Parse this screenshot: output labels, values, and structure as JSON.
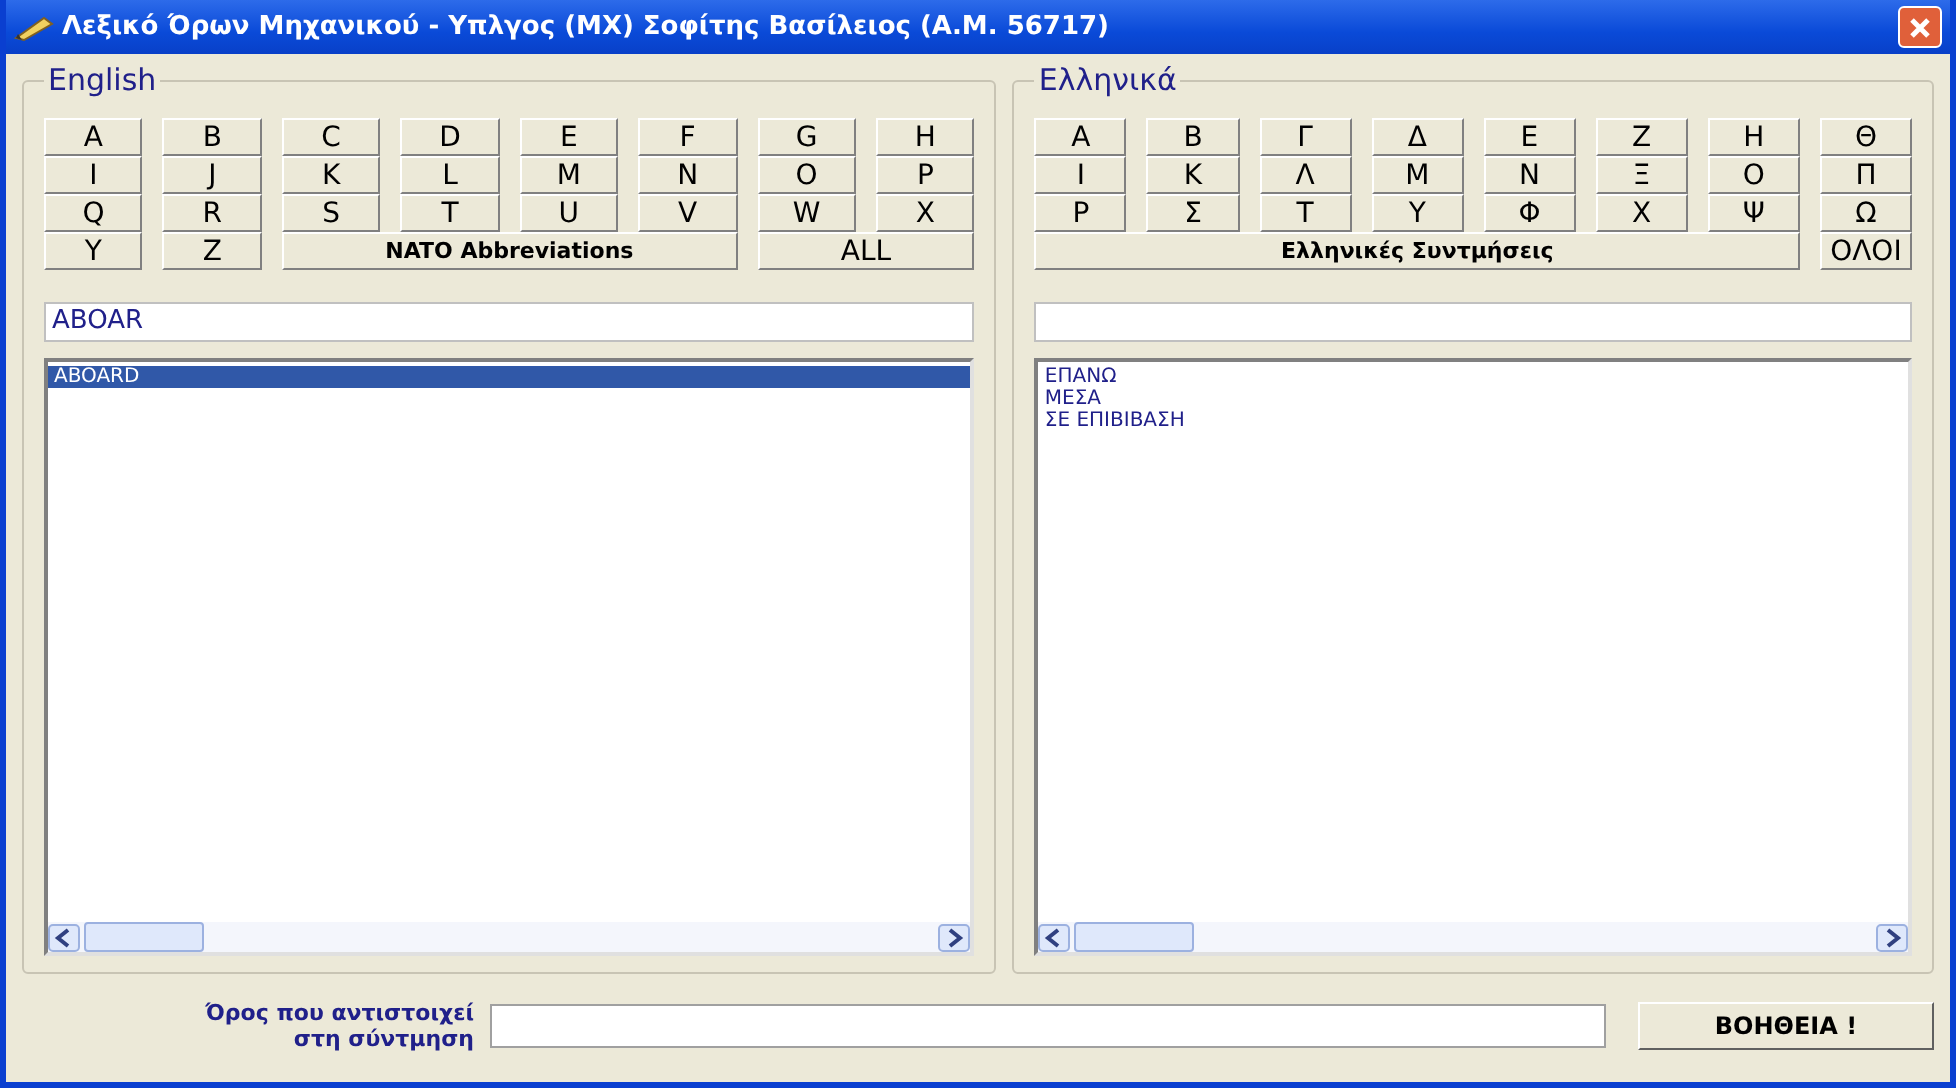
{
  "window": {
    "title": "Λεξικό Όρων Μηχανικού - Υπλγος (ΜΧ) Σοφίτης Βασίλειος (Α.Μ. 56717)"
  },
  "panels": [
    {
      "title": "English",
      "keys": [
        {
          "label": "A",
          "kind": "letter"
        },
        {
          "label": "B",
          "kind": "letter"
        },
        {
          "label": "C",
          "kind": "letter"
        },
        {
          "label": "D",
          "kind": "letter"
        },
        {
          "label": "E",
          "kind": "letter"
        },
        {
          "label": "F",
          "kind": "letter"
        },
        {
          "label": "G",
          "kind": "letter"
        },
        {
          "label": "H",
          "kind": "letter"
        },
        {
          "label": "I",
          "kind": "letter"
        },
        {
          "label": "J",
          "kind": "letter"
        },
        {
          "label": "K",
          "kind": "letter"
        },
        {
          "label": "L",
          "kind": "letter"
        },
        {
          "label": "M",
          "kind": "letter"
        },
        {
          "label": "N",
          "kind": "letter"
        },
        {
          "label": "O",
          "kind": "letter"
        },
        {
          "label": "P",
          "kind": "letter"
        },
        {
          "label": "Q",
          "kind": "letter"
        },
        {
          "label": "R",
          "kind": "letter"
        },
        {
          "label": "S",
          "kind": "letter"
        },
        {
          "label": "T",
          "kind": "letter"
        },
        {
          "label": "U",
          "kind": "letter"
        },
        {
          "label": "V",
          "kind": "letter"
        },
        {
          "label": "W",
          "kind": "letter"
        },
        {
          "label": "X",
          "kind": "letter"
        },
        {
          "label": "Y",
          "kind": "letter"
        },
        {
          "label": "Z",
          "kind": "letter"
        },
        {
          "label": "NATO Abbreviations",
          "kind": "abbrev"
        },
        {
          "label": "ALL",
          "kind": "all"
        }
      ],
      "search": {
        "value": "ABOAR"
      },
      "results": [
        {
          "text": "ABOARD",
          "selected": true
        }
      ]
    },
    {
      "title": "Ελληνικά",
      "keys": [
        {
          "label": "Α",
          "kind": "letter"
        },
        {
          "label": "Β",
          "kind": "letter"
        },
        {
          "label": "Γ",
          "kind": "letter"
        },
        {
          "label": "Δ",
          "kind": "letter"
        },
        {
          "label": "Ε",
          "kind": "letter"
        },
        {
          "label": "Ζ",
          "kind": "letter"
        },
        {
          "label": "Η",
          "kind": "letter"
        },
        {
          "label": "Θ",
          "kind": "letter"
        },
        {
          "label": "Ι",
          "kind": "letter"
        },
        {
          "label": "Κ",
          "kind": "letter"
        },
        {
          "label": "Λ",
          "kind": "letter"
        },
        {
          "label": "Μ",
          "kind": "letter"
        },
        {
          "label": "Ν",
          "kind": "letter"
        },
        {
          "label": "Ξ",
          "kind": "letter"
        },
        {
          "label": "Ο",
          "kind": "letter"
        },
        {
          "label": "Π",
          "kind": "letter"
        },
        {
          "label": "Ρ",
          "kind": "letter"
        },
        {
          "label": "Σ",
          "kind": "letter"
        },
        {
          "label": "Τ",
          "kind": "letter"
        },
        {
          "label": "Υ",
          "kind": "letter"
        },
        {
          "label": "Φ",
          "kind": "letter"
        },
        {
          "label": "Χ",
          "kind": "letter"
        },
        {
          "label": "Ψ",
          "kind": "letter"
        },
        {
          "label": "Ω",
          "kind": "letter"
        },
        {
          "label": "Ελληνικές Συντμήσεις",
          "kind": "abbrev"
        },
        {
          "label": "ΟΛΟΙ",
          "kind": "all"
        }
      ],
      "results": [
        {
          "text": "ΕΠΑΝΩ",
          "selected": false
        },
        {
          "text": "ΜΕΣΑ",
          "selected": false
        },
        {
          "text": "ΣΕ ΕΠΙΒΙΒΑΣΗ",
          "selected": false
        }
      ]
    }
  ],
  "bottom": {
    "label": "Όρος που αντιστοιχεί στη σύντμηση",
    "button": "ΒΟΗΘΕΙΑ !"
  }
}
